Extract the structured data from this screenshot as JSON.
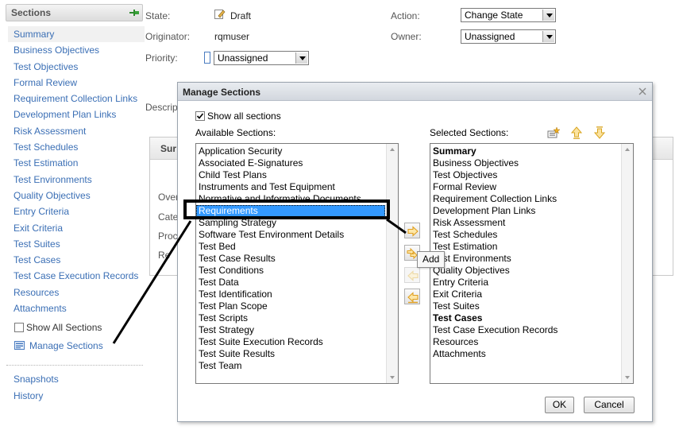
{
  "sidebar": {
    "title": "Sections",
    "pin_icon": "pin-icon",
    "items": [
      {
        "label": "Summary",
        "selected": true
      },
      {
        "label": "Business Objectives"
      },
      {
        "label": "Test Objectives"
      },
      {
        "label": "Formal Review"
      },
      {
        "label": "Requirement Collection Links"
      },
      {
        "label": "Development Plan Links"
      },
      {
        "label": "Risk Assessment"
      },
      {
        "label": "Test Schedules"
      },
      {
        "label": "Test Estimation"
      },
      {
        "label": "Test Environments"
      },
      {
        "label": "Quality Objectives"
      },
      {
        "label": "Entry Criteria"
      },
      {
        "label": "Exit Criteria"
      },
      {
        "label": "Test Suites"
      },
      {
        "label": "Test Cases"
      },
      {
        "label": "Test Case Execution Records"
      },
      {
        "label": "Resources"
      },
      {
        "label": "Attachments"
      }
    ],
    "show_all_label": "Show All Sections",
    "show_all_checked": false,
    "manage_label": "Manage Sections",
    "snapshots_label": "Snapshots",
    "history_label": "History"
  },
  "form": {
    "state_label": "State:",
    "state_value": "Draft",
    "originator_label": "Originator:",
    "originator_value": "rqmuser",
    "priority_label": "Priority:",
    "priority_value": "Unassigned",
    "action_label": "Action:",
    "action_value": "Change State",
    "owner_label": "Owner:",
    "owner_value": "Unassigned",
    "description_clip": "Descrip",
    "summary_clip": "Sur",
    "bg_label_1": "Over",
    "bg_label_2": "Cate",
    "bg_label_3": "Proc",
    "bg_label_4": "Re"
  },
  "dialog": {
    "title": "Manage Sections",
    "show_all_label": "Show all sections",
    "show_all_checked": true,
    "available_label": "Available Sections:",
    "selected_label": "Selected Sections:",
    "available": [
      "Application Security",
      "Associated E-Signatures",
      "Child Test Plans",
      "Instruments and Test Equipment",
      "Normative and Informative Documents",
      "Requirements",
      "Sampling Strategy",
      "Software Test Environment Details",
      "Test Bed",
      "Test Case Results",
      "Test Conditions",
      "Test Data",
      "Test Identification",
      "Test Plan Scope",
      "Test Scripts",
      "Test Strategy",
      "Test Suite Execution Records",
      "Test Suite Results",
      "Test Team"
    ],
    "available_selected_index": 5,
    "selected": [
      {
        "label": "Summary",
        "bold": true
      },
      {
        "label": "Business Objectives"
      },
      {
        "label": "Test Objectives"
      },
      {
        "label": "Formal Review"
      },
      {
        "label": "Requirement Collection Links"
      },
      {
        "label": "Development Plan Links"
      },
      {
        "label": "Risk Assessment"
      },
      {
        "label": "Test Schedules"
      },
      {
        "label": "Test Estimation"
      },
      {
        "label": "Test Environments"
      },
      {
        "label": "Quality Objectives"
      },
      {
        "label": "Entry Criteria"
      },
      {
        "label": "Exit Criteria"
      },
      {
        "label": "Test Suites"
      },
      {
        "label": "Test Cases",
        "bold": true
      },
      {
        "label": "Test Case Execution Records"
      },
      {
        "label": "Resources"
      },
      {
        "label": "Attachments"
      }
    ],
    "tooltip": "Add",
    "ok_label": "OK",
    "cancel_label": "Cancel"
  },
  "colors": {
    "link": "#3b6fb5",
    "selection": "#3399ff",
    "move_icon": "#e0a020"
  }
}
